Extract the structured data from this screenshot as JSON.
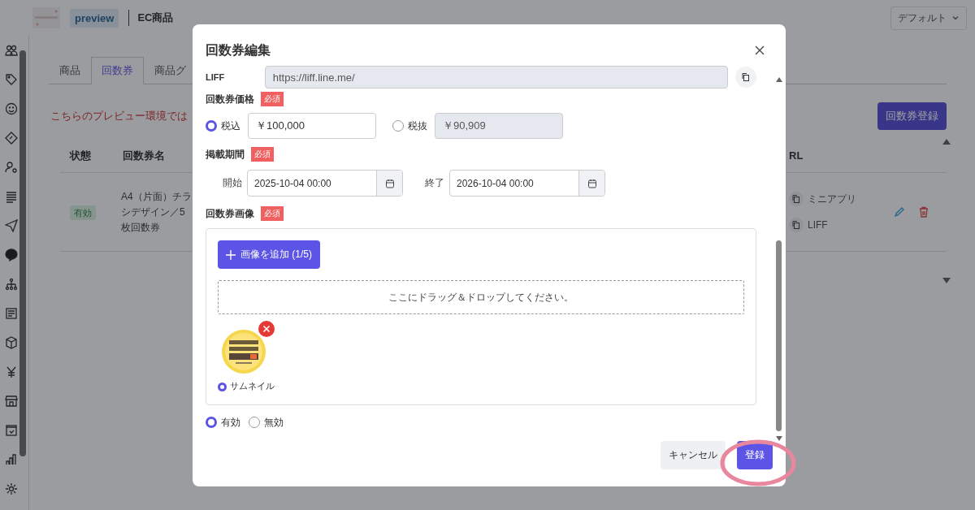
{
  "header": {
    "badge": "preview",
    "title": "EC商品",
    "dropdown": "デフォルト"
  },
  "tabs": [
    {
      "label": "商品",
      "selected": false
    },
    {
      "label": "回数券",
      "selected": true
    },
    {
      "label": "商品グ",
      "selected": false
    }
  ],
  "notice": "こちらのプレビュー環境では",
  "register_button": "回数券登録",
  "table": {
    "columns": [
      "状態",
      "回数券名",
      "RL"
    ],
    "rows": [
      {
        "status": "有効",
        "name": "A4（片面）チラシデザイン／5枚回数券",
        "links": [
          "ミニアプリ",
          "LIFF"
        ]
      }
    ]
  },
  "modal": {
    "title": "回数券編集",
    "liff": {
      "label": "LIFF",
      "value": "https://liff.line.me/"
    },
    "price": {
      "label": "回数券価格",
      "required": "必須",
      "options": [
        {
          "label": "税込",
          "value": "￥100,000",
          "selected": true
        },
        {
          "label": "税抜",
          "value": "￥90,909",
          "selected": false
        }
      ]
    },
    "period": {
      "label": "掲載期間",
      "required": "必須",
      "start_label": "開始",
      "start": "2025-10-04 00:00",
      "end_label": "終了",
      "end": "2026-10-04 00:00"
    },
    "image": {
      "label": "回数券画像",
      "required": "必須",
      "add_button": "画像を追加 (1/5)",
      "dropzone": "ここにドラッグ＆ドロップしてください。",
      "thumbnails": [
        {
          "kind": "picture",
          "label": "サムネイル",
          "selected": true
        }
      ]
    },
    "status": [
      {
        "label": "有効",
        "selected": true
      },
      {
        "label": "無効",
        "selected": false
      }
    ],
    "buttons": {
      "cancel": "キャンセル",
      "submit": "登録"
    }
  }
}
